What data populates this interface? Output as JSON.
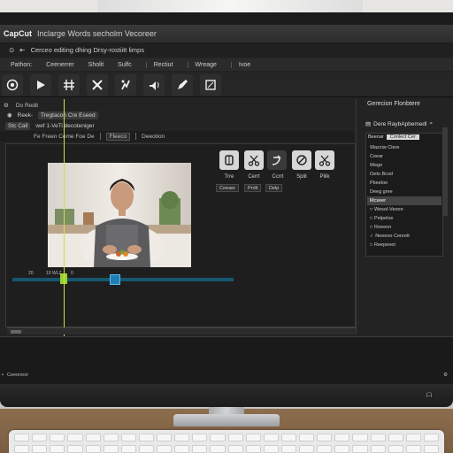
{
  "window": {
    "app_name": "CapCut",
    "doc_title": "Inclarge Words secholm Vecoreer"
  },
  "subtitle": {
    "text": "Cerceo editing dhing Drsy-rostiitt limps"
  },
  "menu": [
    "Pathon:",
    "Ceenerrer",
    "Sholit",
    "Sulfc",
    "Rectiut",
    "Wreage",
    "Ivoe"
  ],
  "panel_tabs": {
    "left_label": "Do Redit",
    "right_title": "Gerecion Flonbtere"
  },
  "row2": {
    "a": "Reek-",
    "b": "Tregtacon Cre Eseed"
  },
  "row3": {
    "a": "Stc Call",
    "b": "wef  1-VeTi decoteniger"
  },
  "row4": {
    "a": "Fe Freen Ceme Foe De",
    "b": "Fleeco",
    "c": "Deeotion"
  },
  "edit_tools": {
    "labels": [
      "Trre",
      "Cerrt",
      "Ccrrt",
      "Split",
      "Plilk"
    ],
    "options": [
      "Ceeaer",
      "Prrilt",
      "Delp"
    ]
  },
  "timeline": {
    "markers": [
      "20",
      "10 WLZ",
      "0"
    ]
  },
  "right_panel": {
    "header": "Dere RaybApbemedl",
    "tabs": [
      "Beenar",
      "Conlect Cer"
    ],
    "list": [
      {
        "label": "Wazciw Clere",
        "style": "plain"
      },
      {
        "label": "Ceear",
        "style": "plain"
      },
      {
        "label": "Wege",
        "style": "plain"
      },
      {
        "label": "Oeto Bcod",
        "style": "plain"
      },
      {
        "label": "Pbeeloe",
        "style": "plain"
      },
      {
        "label": "Deeg gree",
        "style": "plain"
      },
      {
        "label": "Mcseer",
        "style": "selected"
      },
      {
        "label": "Wesol-Veoon",
        "style": "box"
      },
      {
        "label": "Pelpeloe",
        "style": "box"
      },
      {
        "label": "Reeeon",
        "style": "box"
      },
      {
        "label": "Neeeno Cenrelt",
        "style": "check"
      },
      {
        "label": "Reepeeet",
        "style": "box"
      }
    ]
  },
  "status": {
    "text": "Ceeoneor"
  },
  "colors": {
    "accent": "#1f7fb5",
    "playhead": "#d8d84a",
    "clip_start": "#9bd12e"
  }
}
